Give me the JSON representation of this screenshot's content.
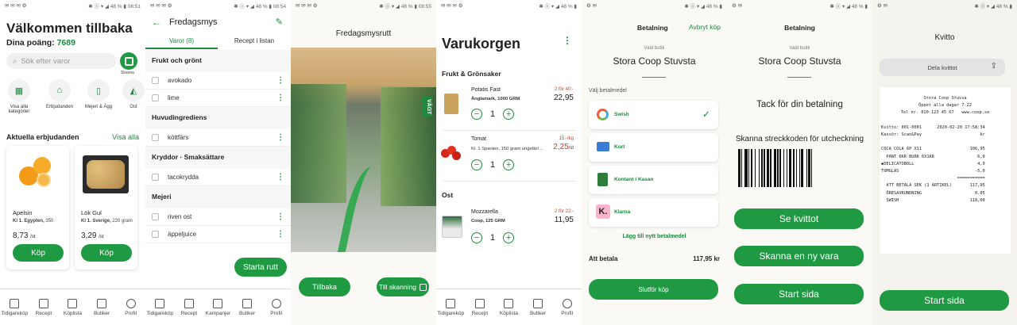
{
  "status": [
    {
      "left": "✉ ✉ ✉ ⚙",
      "right": "✱ ⓝ ▾ ◢ 48 % ▮ 08:51"
    },
    {
      "left": "✉ ✉ ✉ ⚙",
      "right": "✱ ⓝ ▾ ◢ 48 % ▮ 08:54"
    },
    {
      "left": "✉ ✉ ✉ ⚙",
      "right": "✱ ⓝ ▾ ◢ 48 % ▮ 08:55"
    },
    {
      "left": "✉ ✉ ✉ ⚙",
      "right": "✱ ⓝ ▾ ◢ 48 % ▮"
    },
    {
      "left": "⚙ ✉",
      "right": "✱ ⓝ ▾ ◢ 48 % ▮"
    },
    {
      "left": "⚙ ✉",
      "right": "✱ ⓝ ▾ ◢ 48 % ▮"
    },
    {
      "left": "⚙ ✉",
      "right": "✱ ⓝ ▾ ◢ 48 % ▮"
    }
  ],
  "home": {
    "title": "Välkommen tillbaka",
    "points_label": "Dina poäng:",
    "points_value": "7689",
    "search_placeholder": "Sök efter varor",
    "scan_label": "Skanna",
    "categories": [
      "Visa alla kategorier",
      "Erbjudanden",
      "Mejeri & Ägg",
      "Ost"
    ],
    "offers_title": "Aktuella erbjudanden",
    "offers_link": "Visa alla",
    "offers": [
      {
        "name": "Apelsin",
        "origin": "Kl 1. Egypten,",
        "weight": "350",
        "price": "8,73",
        "unit": "/st",
        "buy": "Köp"
      },
      {
        "name": "Lök Gul",
        "origin": "Kl 1. Sverige,",
        "weight": "220 gram",
        "price": "3,29",
        "unit": "/st",
        "buy": "Köp"
      }
    ]
  },
  "nav1": [
    "Tidigareköp",
    "Recept",
    "Köplista",
    "Butiker",
    "Profil"
  ],
  "nav2": [
    "Tidigareköp",
    "Recept",
    "Kampanjer",
    "Butiker",
    "Profil"
  ],
  "nav4": [
    "Tidigareköp",
    "Recept",
    "Köplista",
    "Butiker",
    "Profil"
  ],
  "list": {
    "title": "Fredagsmys",
    "tab_items": "Varor (8)",
    "tab_recipes": "Recept i listan",
    "sections": [
      {
        "name": "Frukt och grönt",
        "items": [
          "avokado",
          "lime"
        ]
      },
      {
        "name": "Huvudingrediens",
        "items": [
          "köttfärs"
        ]
      },
      {
        "name": "Kryddor · Smaksättare",
        "items": [
          "tacokrydda"
        ]
      },
      {
        "name": "Mejeri",
        "items": [
          "riven ost",
          "äppeljuice"
        ]
      }
    ],
    "start_button": "Starta rutt"
  },
  "route": {
    "title": "Fredagsmysrutt",
    "back": "Tillbaka",
    "scan": "Till skanning",
    "sign": "VÄGT"
  },
  "cart": {
    "title": "Varukorgen",
    "sections": [
      {
        "name": "Frukt & Grönsaker"
      },
      {
        "name": "Ost"
      }
    ],
    "items": [
      {
        "name": "Potatis Fast",
        "desc": "Änglamark, 1000 GRM",
        "offer": "2 för 40:-",
        "price": "22,95",
        "qty": "1"
      },
      {
        "name": "Tomat",
        "desc": "Kl. 1 Spanien, 150 gram ungefärl…",
        "offer": "15:-/kg",
        "price": "2,25",
        "price_unit": "/st",
        "qty": "1"
      },
      {
        "name": "Mozzarella",
        "desc": "Coop, 125 GRM",
        "offer": "2 för 22:-",
        "price": "11,95",
        "qty": "1"
      }
    ]
  },
  "payment": {
    "title": "Betalning",
    "cancel": "Avbryt köp",
    "store_label": "Vald butik",
    "store": "Stora Coop Stuvsta",
    "choose": "Välj betalmedel",
    "methods": [
      "Swish",
      "Kort",
      "Kontant i Kasan",
      "Klarna"
    ],
    "add": "Lägg till nytt betalmedel",
    "total_label": "Att betala",
    "total": "117,95 kr",
    "finish": "Slutför köp"
  },
  "done": {
    "title": "Betalning",
    "store_label": "Vald butik",
    "store": "Stora Coop Stuvsta",
    "thanks": "Tack för din betalning",
    "scan_text": "Skanna streckkoden för utcheckning",
    "buttons": [
      "Se kvittot",
      "Skanna en ny vara",
      "Start sida"
    ]
  },
  "receipt": {
    "title": "Kvitto",
    "share": "Dela kvittot",
    "lines": [
      "Stora Coop Stuvsa",
      "Öppet alla dagar 7-22",
      "Tel nr. 010-123 45 67   www.coop.se",
      "",
      "Kvitto: 001-0001      2020-02-20 17:58:34",
      "Kassör: Scan&Pay                       kr",
      "",
      "COCA COLA 6P X11                   106,95",
      "  PANT 6KR BURK 6X1KR                 6,0",
      "◆DELICATOBOLL                         4,0",
      "TOMGLAS                              -5,0",
      "                              ===========",
      "  ATT BETALA SEK (1 ARTIKEL)       117,95",
      "  ÖRESAVRUNDNING                     0.05",
      "  SWISH                            118,00"
    ],
    "start": "Start sida"
  }
}
